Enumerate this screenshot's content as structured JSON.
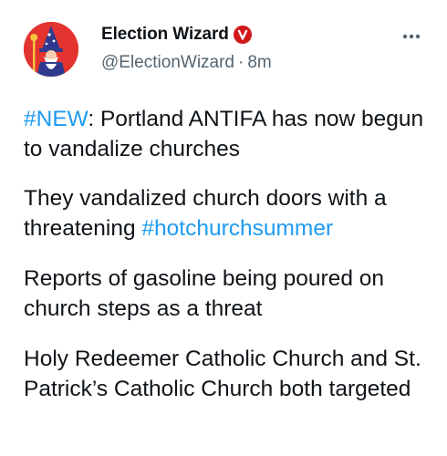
{
  "author": {
    "display_name": "Election Wizard",
    "handle": "@ElectionWizard",
    "separator": "·",
    "time": "8m"
  },
  "colors": {
    "hashtag": "#1d9bf0",
    "badge": "#d0181b",
    "avatar_bg": "#e3342f"
  },
  "icons": {
    "more": "more-options-icon",
    "badge": "verified-badge-icon",
    "avatar": "wizard-avatar"
  },
  "tweet": {
    "p1": {
      "hashtag": "#NEW",
      "text": ": Portland ANTIFA has now begun to vandalize churches"
    },
    "p2": {
      "text": "They vandalized church doors with a threatening ",
      "hashtag": "#hotchurchsummer"
    },
    "p3": {
      "text": "Reports of gasoline being poured on church steps as a threat"
    },
    "p4": {
      "text": "Holy Redeemer Catholic Church and St. Patrick’s Catholic Church both targeted"
    }
  }
}
